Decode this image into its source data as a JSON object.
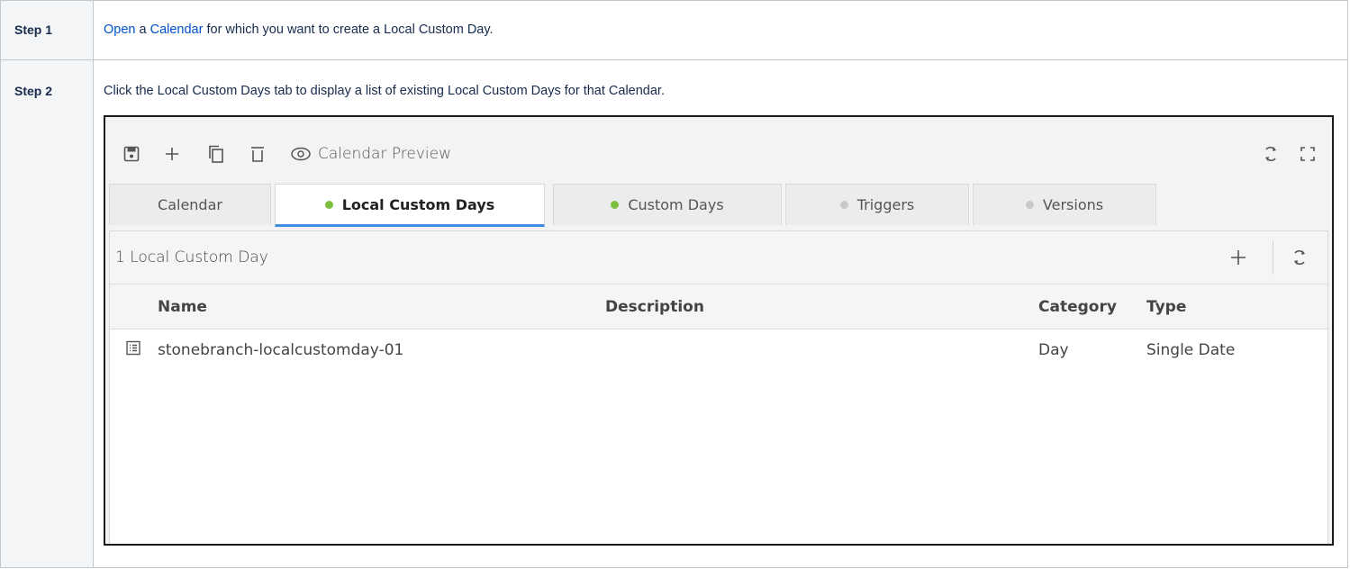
{
  "steps": [
    {
      "label": "Step 1",
      "link_open": "Open",
      "text_a": " a ",
      "link_calendar": "Calendar",
      "text_b": " for which you want to create a Local Custom Day."
    },
    {
      "label": "Step 2",
      "text": "Click the Local Custom Days tab to display a list of existing Local Custom Days for that Calendar."
    }
  ],
  "screenshot": {
    "toolbar": {
      "icons": [
        "save-icon",
        "plus-icon",
        "copy-icon",
        "trash-icon",
        "eye-icon",
        "refresh-icon",
        "expand-icon"
      ],
      "preview_label": "Calendar Preview"
    },
    "tabs": [
      {
        "label": "Calendar",
        "active": false,
        "dot": "none"
      },
      {
        "label": "Local Custom Days",
        "active": true,
        "dot": "green"
      },
      {
        "label": "Custom Days",
        "active": false,
        "dot": "green"
      },
      {
        "label": "Triggers",
        "active": false,
        "dot": "grey"
      },
      {
        "label": "Versions",
        "active": false,
        "dot": "grey"
      }
    ],
    "panel": {
      "title": "1 Local Custom Day",
      "columns": [
        "Name",
        "Description",
        "Category",
        "Type"
      ],
      "rows": [
        {
          "name": "stonebranch-localcustomday-01",
          "description": "",
          "category": "Day",
          "type": "Single Date"
        }
      ]
    },
    "colors": {
      "link": "#0052cc",
      "active_tab_underline": "#3d8ee0",
      "dot_green": "#7fbf3f",
      "dot_grey": "#c8c8c8"
    }
  }
}
